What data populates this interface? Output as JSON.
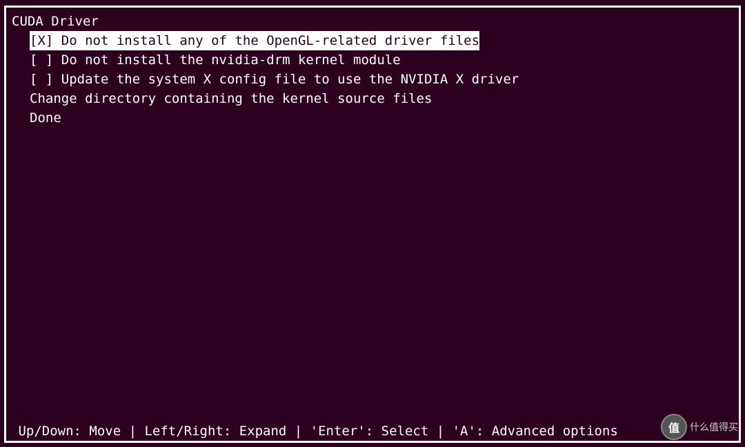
{
  "title": "CUDA Driver",
  "options": [
    {
      "checkbox": "[X]",
      "label": "Do not install any of the OpenGL-related driver files",
      "selected": true
    },
    {
      "checkbox": "[ ]",
      "label": "Do not install the nvidia-drm kernel module",
      "selected": false
    },
    {
      "checkbox": "[ ]",
      "label": "Update the system X config file to use the NVIDIA X driver",
      "selected": false
    }
  ],
  "actions": [
    "Change directory containing the kernel source files",
    "Done"
  ],
  "footer": " Up/Down: Move | Left/Right: Expand | 'Enter': Select | 'A': Advanced options",
  "watermark": {
    "icon": "值",
    "text": "什么值得买"
  }
}
